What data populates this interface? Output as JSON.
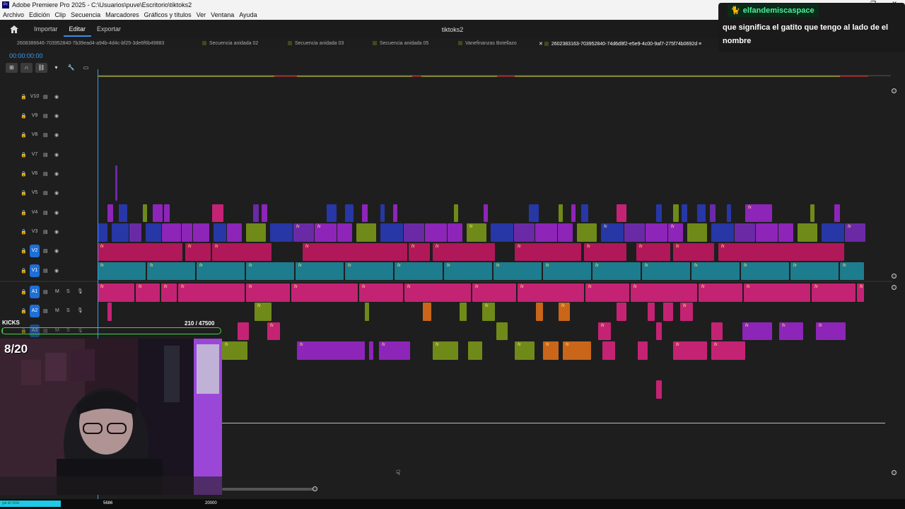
{
  "window": {
    "title": "Adobe Premiere Pro 2025 - C:\\Usuarios\\puve\\Escritorio\\tiktoks2",
    "logo": "Pr"
  },
  "menu": [
    "Archivo",
    "Edición",
    "Clip",
    "Secuencia",
    "Marcadores",
    "Gráficos y títulos",
    "Ver",
    "Ventana",
    "Ayuda"
  ],
  "header": {
    "tabs": [
      "Importar",
      "Editar",
      "Exportar"
    ],
    "active_tab": "Editar",
    "project": "tiktoks2"
  },
  "sequence_tabs": [
    "2608386646-703952840-7b39ead4-a94b-4d4c-bf25-3de6f6b49883",
    "Secuencia anidada 02",
    "Secuencia anidada 03",
    "Secuencia anidada 05",
    "Vanefinanzas Botellazo",
    "2602383163-703952840-74d6d9f2-e5e9-4c00-9af7-275f74b0692d"
  ],
  "timecode": "00:00:00:00",
  "tracks": {
    "video": [
      "V10",
      "V9",
      "V8",
      "V7",
      "V6",
      "V5",
      "V4",
      "V3",
      "V2",
      "V1"
    ],
    "audio": [
      "A1",
      "A2",
      "A3"
    ],
    "selected": [
      "V2",
      "V1",
      "A1",
      "A2"
    ],
    "audio_controls": {
      "mute": "M",
      "solo": "S"
    }
  },
  "overlay": {
    "chat_user": "elfandemiscaspace",
    "chat_message": "que significa el gatito que tengo al lado de el nombre",
    "kicks_label": "KICKS",
    "kicks_count": "210  / 47500",
    "kicks_progress": 0.0044,
    "counter": "8/20"
  },
  "statusbar": {
    "left": "ya el mío",
    "mid": "5686",
    "right": "20000"
  },
  "colors": {
    "magenta": "#b0185a",
    "teal": "#1d7c8e",
    "olive": "#6f8a19",
    "violet": "#6a2aa6",
    "blue": "#2737a6",
    "orange": "#c9661a",
    "pink": "#c42374",
    "purple": "#8d25b8",
    "accent": "#3a9bf0"
  }
}
